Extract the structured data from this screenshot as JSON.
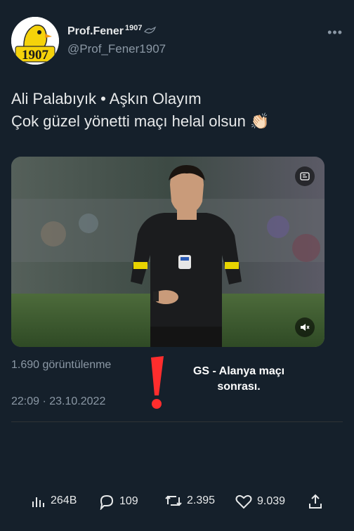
{
  "author": {
    "display_name": "Prof.Fener",
    "name_superscript": "1907",
    "handle": "@Prof_Fener1907",
    "avatar_text": "1907"
  },
  "tweet": {
    "line1": "Ali Palabıyık • Aşkın Olayım",
    "line2": "Çok güzel yönetti maçı helal olsun 👏🏻"
  },
  "meta": {
    "views": "1.690 görüntülenme",
    "timestamp": "22:09 · 23.10.2022"
  },
  "annotation": {
    "text": "GS - Alanya maçı sonrası."
  },
  "actions": {
    "views_count": "264B",
    "replies": "109",
    "retweets": "2.395",
    "likes": "9.039"
  },
  "colors": {
    "background": "#15202b",
    "text": "#e7e9ea",
    "muted": "#8b98a5",
    "annotation": "#ff2d2d"
  },
  "icons": [
    "more-icon",
    "bird-icon",
    "gif-icon",
    "mute-icon",
    "views-icon",
    "reply-icon",
    "retweet-icon",
    "like-icon",
    "share-icon"
  ]
}
